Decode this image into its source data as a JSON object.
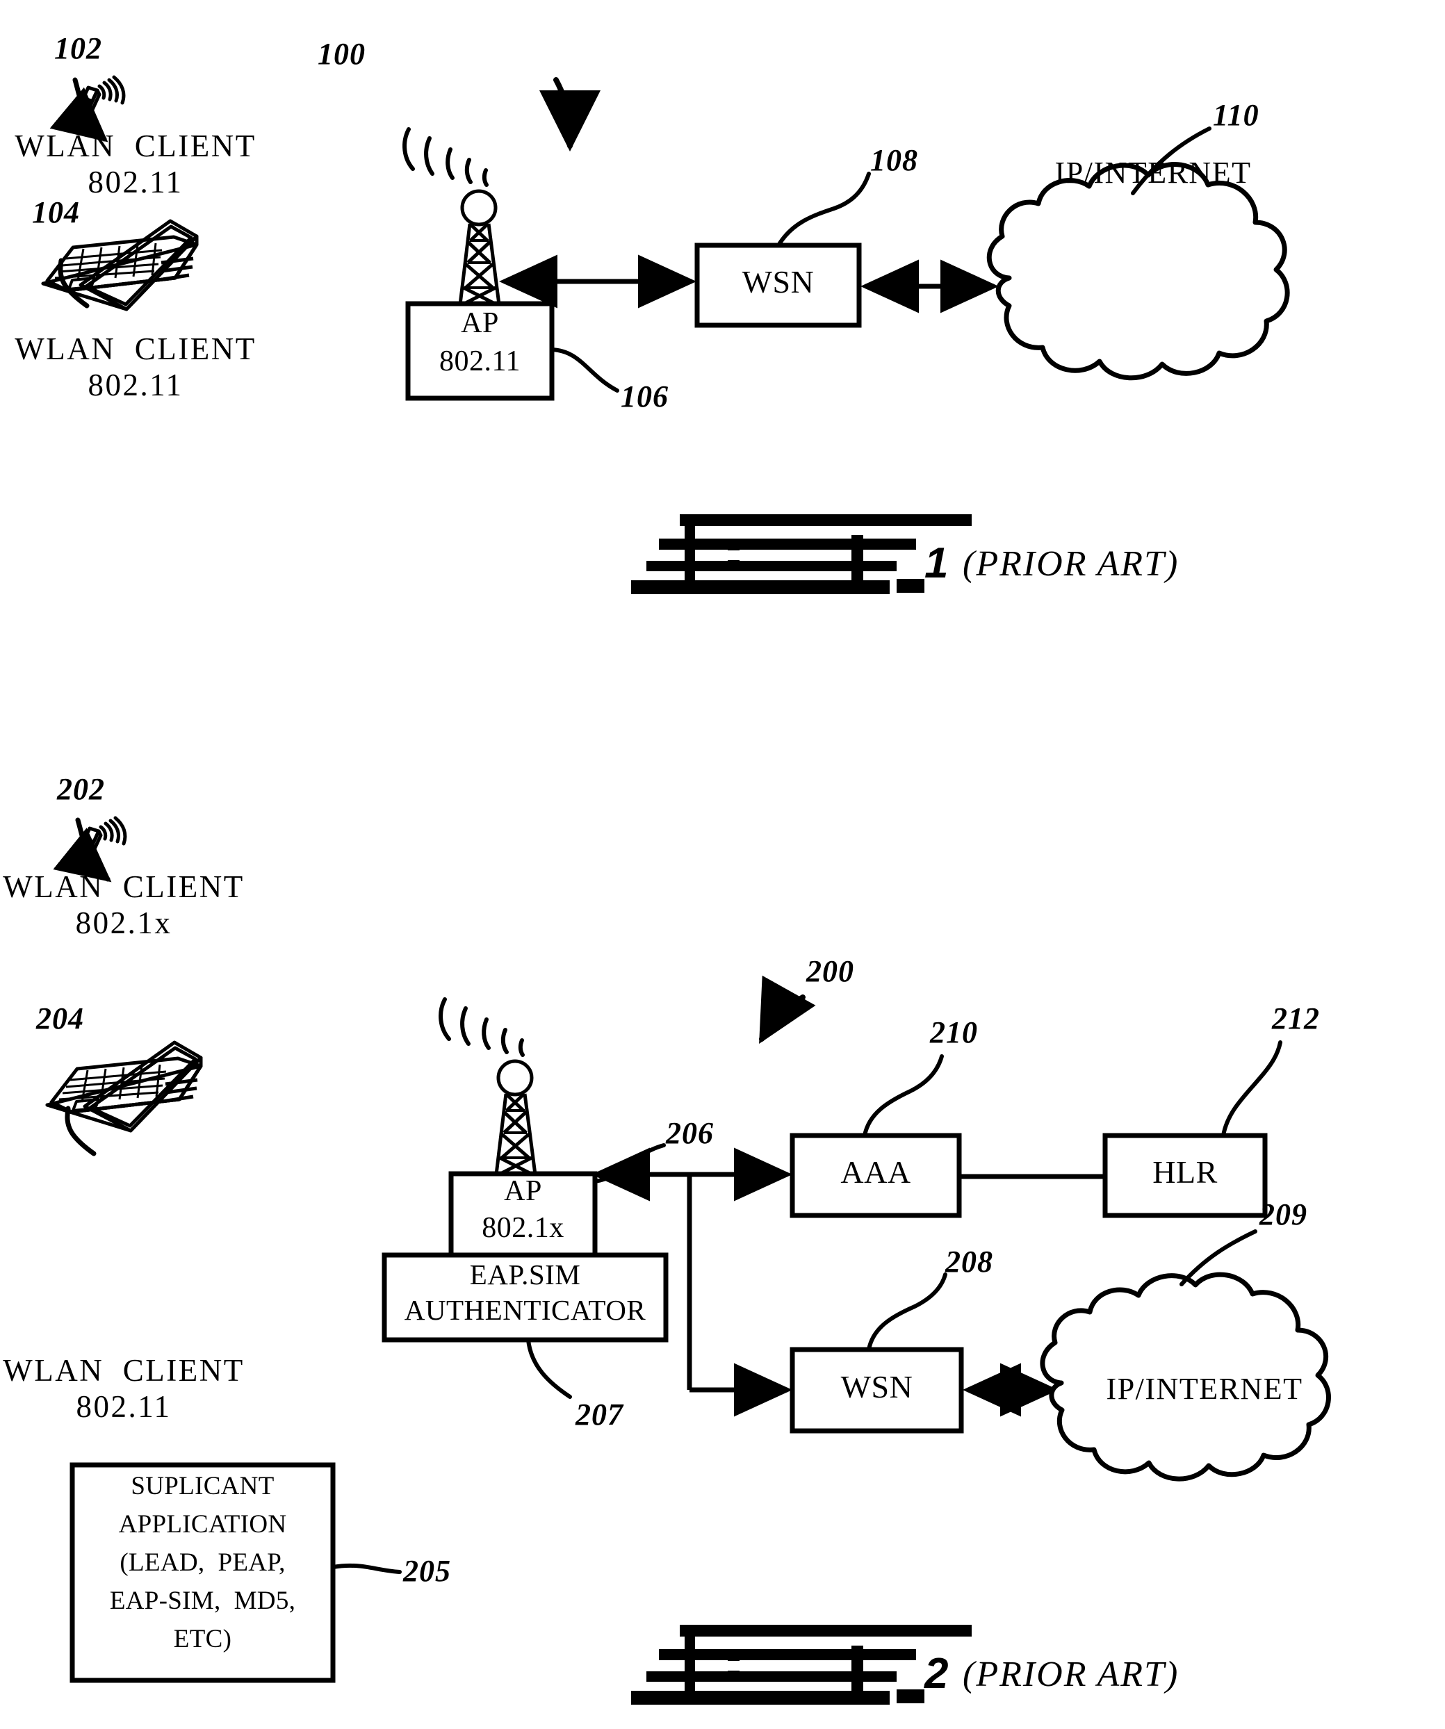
{
  "document": {
    "type": "patent-drawing-sheet",
    "background_color": "#ffffff",
    "ink_color": "#000000"
  },
  "figures": [
    {
      "id": "figure-1",
      "system_ref": "100",
      "caption_text": "(PRIOR ART)",
      "caption_number": "1",
      "nodes": [
        {
          "ref": "102",
          "label_line1": "WLAN  CLIENT",
          "label_line2": "802.11",
          "icon": "mobile-phone-wireless"
        },
        {
          "ref": "104",
          "label_line1": "WLAN  CLIENT",
          "label_line2": "802.11",
          "icon": "laptop"
        },
        {
          "ref": "106",
          "label_line1": "AP",
          "label_line2": "802.11",
          "icon": "antenna-tower"
        },
        {
          "ref": "108",
          "label_line1": "WSN",
          "label_line2": "",
          "icon": "box"
        },
        {
          "ref": "110",
          "label_line1": "IP/INTERNET",
          "label_line2": "",
          "icon": "cloud"
        }
      ]
    },
    {
      "id": "figure-2",
      "system_ref": "200",
      "caption_text": "(PRIOR ART)",
      "caption_number": "2",
      "nodes": [
        {
          "ref": "202",
          "label_line1": "WLAN  CLIENT",
          "label_line2": "802.1x",
          "icon": "mobile-phone-wireless"
        },
        {
          "ref": "204",
          "label_line1": "WLAN  CLIENT",
          "label_line2": "802.11",
          "icon": "laptop"
        },
        {
          "ref": "205",
          "label_lines": [
            "SUPLICANT",
            "APPLICATION",
            "(LEAD,  PEAP,",
            "EAP-SIM,  MD5,",
            "ETC)"
          ],
          "icon": "box"
        },
        {
          "ref": "206",
          "label_line1": "AP",
          "label_line2": "802.1x",
          "icon": "antenna-tower"
        },
        {
          "ref": "207",
          "label_line1": "EAP.SIM",
          "label_line2": "AUTHENTICATOR",
          "icon": "box"
        },
        {
          "ref": "208",
          "label_line1": "WSN",
          "label_line2": "",
          "icon": "box"
        },
        {
          "ref": "209",
          "label_line1": "IP/INTERNET",
          "label_line2": "",
          "icon": "cloud"
        },
        {
          "ref": "210",
          "label_line1": "AAA",
          "label_line2": "",
          "icon": "box"
        },
        {
          "ref": "212",
          "label_line1": "HLR",
          "label_line2": "",
          "icon": "box"
        }
      ]
    }
  ],
  "fig1": {
    "ref_100": "100",
    "ref_102": "102",
    "ref_104": "104",
    "ref_106": "106",
    "ref_108": "108",
    "ref_110": "110",
    "client1_line1": "WLAN  CLIENT",
    "client1_line2": "802.11",
    "client2_line1": "WLAN  CLIENT",
    "client2_line2": "802.11",
    "ap_line1": "AP",
    "ap_line2": "802.11",
    "wsn": "WSN",
    "cloud": "IP/INTERNET",
    "fig_label": "1",
    "prior_art": "(PRIOR ART)"
  },
  "fig2": {
    "ref_200": "200",
    "ref_202": "202",
    "ref_204": "204",
    "ref_205": "205",
    "ref_206": "206",
    "ref_207": "207",
    "ref_208": "208",
    "ref_209": "209",
    "ref_210": "210",
    "ref_212": "212",
    "client1_line1": "WLAN  CLIENT",
    "client1_line2": "802.1x",
    "client2_line1": "WLAN  CLIENT",
    "client2_line2": "802.11",
    "ap_line1": "AP",
    "ap_line2": "802.1x",
    "auth_line1": "EAP.SIM",
    "auth_line2": "AUTHENTICATOR",
    "supplicant_l1": "SUPLICANT",
    "supplicant_l2": "APPLICATION",
    "supplicant_l3": "(LEAD,  PEAP,",
    "supplicant_l4": "EAP-SIM,  MD5,",
    "supplicant_l5": "ETC)",
    "aaa": "AAA",
    "hlr": "HLR",
    "wsn": "WSN",
    "cloud": "IP/INTERNET",
    "fig_label": "2",
    "prior_art": "(PRIOR ART)"
  }
}
